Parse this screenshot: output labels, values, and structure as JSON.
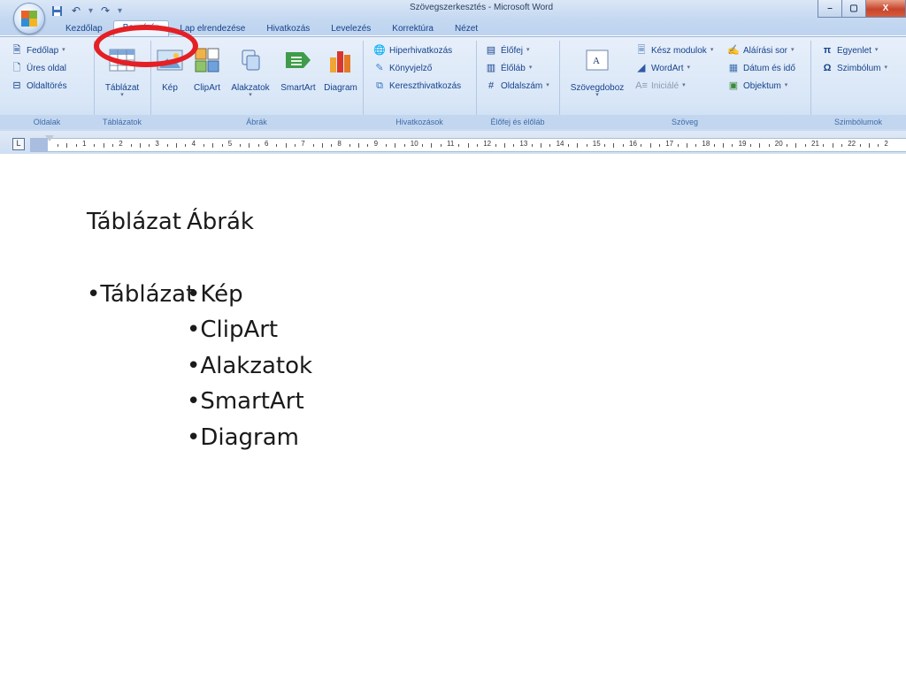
{
  "window": {
    "title": "Szövegszerkesztés - Microsoft Word",
    "controls": [
      "–",
      "▢",
      "X"
    ]
  },
  "quick_access": {
    "save_icon": "save-icon",
    "undo_icon": "undo-icon",
    "redo_icon": "redo-icon",
    "customize_icon": "customize-icon"
  },
  "tabs": [
    "Kezdőlap",
    "Beszúrás",
    "Lap elrendezése",
    "Hivatkozás",
    "Levelezés",
    "Korrektúra",
    "Nézet"
  ],
  "active_tab": "Beszúrás",
  "ribbon": {
    "oldalak": {
      "label": "Oldalak",
      "items": [
        "Fedőlap",
        "Üres oldal",
        "Oldaltörés"
      ]
    },
    "tablazatok": {
      "label": "Táblázatok",
      "table": "Táblázat"
    },
    "abrak": {
      "label": "Ábrák",
      "items": [
        "Kép",
        "ClipArt",
        "Alakzatok",
        "SmartArt",
        "Diagram"
      ]
    },
    "hivatkozasok": {
      "label": "Hivatkozások",
      "items": [
        "Hiperhivatkozás",
        "Könyvjelző",
        "Kereszthivatkozás"
      ]
    },
    "elofej": {
      "label": "Élőfej és élőláb",
      "items": [
        "Élőfej",
        "Élőláb",
        "Oldalszám"
      ]
    },
    "szoveg": {
      "label": "Szöveg",
      "textbox": "Szövegdoboz",
      "items": [
        "Kész modulok",
        "WordArt",
        "Iniciálé",
        "Aláírási sor",
        "Dátum és idő",
        "Objektum"
      ]
    },
    "szimbolumok": {
      "label": "Szimbólumok",
      "items": [
        "Egyenlet",
        "Szimbólum"
      ]
    }
  },
  "ruler": {
    "numbers": [
      "1",
      "2",
      "3",
      "4",
      "5",
      "6",
      "7",
      "8",
      "9",
      "10",
      "11",
      "12",
      "13",
      "14",
      "15",
      "16",
      "17",
      "18",
      "19",
      "20",
      "21",
      "22",
      "2"
    ]
  },
  "slide": {
    "heading_left": "Táblázat",
    "heading_right": "Ábrák",
    "left_bullet": "•Táblázat",
    "right_bullets": [
      "•Kép",
      "•ClipArt",
      "•Alakzatok",
      "•SmartArt",
      "•Diagram"
    ]
  },
  "colors": {
    "ribbon_text": "#15428b",
    "annotation_circle": "#e41f25"
  }
}
